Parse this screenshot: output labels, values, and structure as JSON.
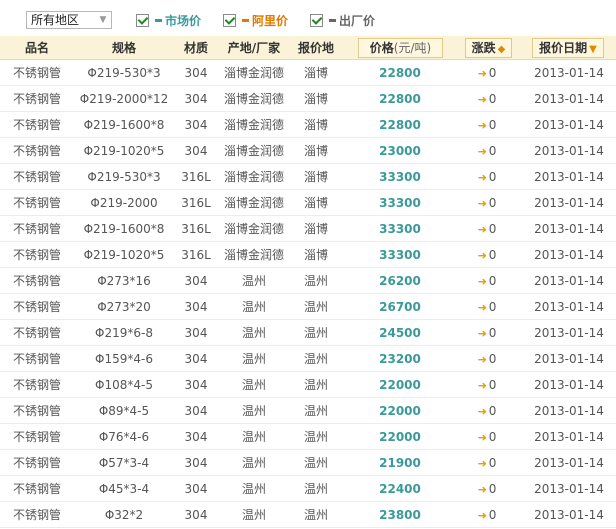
{
  "filter": {
    "region": "所有地区"
  },
  "legend": [
    {
      "label": "市场价",
      "color": "#3a9a9a"
    },
    {
      "label": "阿里价",
      "color": "#e07a00"
    },
    {
      "label": "出厂价",
      "color": "#666666"
    }
  ],
  "columns": {
    "name": "品名",
    "spec": "规格",
    "material": "材质",
    "maker": "产地/厂家",
    "place": "报价地",
    "price": "价格",
    "price_unit": "(元/吨)",
    "change": "涨跌",
    "date": "报价日期"
  },
  "rows": [
    {
      "name": "不锈钢管",
      "spec": "Φ219-530*3",
      "material": "304",
      "maker": "淄博金润德",
      "place": "淄博",
      "price": "22800",
      "change": "0",
      "date": "2013-01-14"
    },
    {
      "name": "不锈钢管",
      "spec": "Φ219-2000*12",
      "material": "304",
      "maker": "淄博金润德",
      "place": "淄博",
      "price": "22800",
      "change": "0",
      "date": "2013-01-14"
    },
    {
      "name": "不锈钢管",
      "spec": "Φ219-1600*8",
      "material": "304",
      "maker": "淄博金润德",
      "place": "淄博",
      "price": "22800",
      "change": "0",
      "date": "2013-01-14"
    },
    {
      "name": "不锈钢管",
      "spec": "Φ219-1020*5",
      "material": "304",
      "maker": "淄博金润德",
      "place": "淄博",
      "price": "23000",
      "change": "0",
      "date": "2013-01-14"
    },
    {
      "name": "不锈钢管",
      "spec": "Φ219-530*3",
      "material": "316L",
      "maker": "淄博金润德",
      "place": "淄博",
      "price": "33300",
      "change": "0",
      "date": "2013-01-14"
    },
    {
      "name": "不锈钢管",
      "spec": "Φ219-2000",
      "material": "316L",
      "maker": "淄博金润德",
      "place": "淄博",
      "price": "33300",
      "change": "0",
      "date": "2013-01-14"
    },
    {
      "name": "不锈钢管",
      "spec": "Φ219-1600*8",
      "material": "316L",
      "maker": "淄博金润德",
      "place": "淄博",
      "price": "33300",
      "change": "0",
      "date": "2013-01-14"
    },
    {
      "name": "不锈钢管",
      "spec": "Φ219-1020*5",
      "material": "316L",
      "maker": "淄博金润德",
      "place": "淄博",
      "price": "33300",
      "change": "0",
      "date": "2013-01-14"
    },
    {
      "name": "不锈钢管",
      "spec": "Φ273*16",
      "material": "304",
      "maker": "温州",
      "place": "温州",
      "price": "26200",
      "change": "0",
      "date": "2013-01-14"
    },
    {
      "name": "不锈钢管",
      "spec": "Φ273*20",
      "material": "304",
      "maker": "温州",
      "place": "温州",
      "price": "26700",
      "change": "0",
      "date": "2013-01-14"
    },
    {
      "name": "不锈钢管",
      "spec": "Φ219*6-8",
      "material": "304",
      "maker": "温州",
      "place": "温州",
      "price": "24500",
      "change": "0",
      "date": "2013-01-14"
    },
    {
      "name": "不锈钢管",
      "spec": "Φ159*4-6",
      "material": "304",
      "maker": "温州",
      "place": "温州",
      "price": "23200",
      "change": "0",
      "date": "2013-01-14"
    },
    {
      "name": "不锈钢管",
      "spec": "Φ108*4-5",
      "material": "304",
      "maker": "温州",
      "place": "温州",
      "price": "22000",
      "change": "0",
      "date": "2013-01-14"
    },
    {
      "name": "不锈钢管",
      "spec": "Φ89*4-5",
      "material": "304",
      "maker": "温州",
      "place": "温州",
      "price": "22000",
      "change": "0",
      "date": "2013-01-14"
    },
    {
      "name": "不锈钢管",
      "spec": "Φ76*4-6",
      "material": "304",
      "maker": "温州",
      "place": "温州",
      "price": "22000",
      "change": "0",
      "date": "2013-01-14"
    },
    {
      "name": "不锈钢管",
      "spec": "Φ57*3-4",
      "material": "304",
      "maker": "温州",
      "place": "温州",
      "price": "21900",
      "change": "0",
      "date": "2013-01-14"
    },
    {
      "name": "不锈钢管",
      "spec": "Φ45*3-4",
      "material": "304",
      "maker": "温州",
      "place": "温州",
      "price": "22400",
      "change": "0",
      "date": "2013-01-14"
    },
    {
      "name": "不锈钢管",
      "spec": "Φ32*2",
      "material": "304",
      "maker": "温州",
      "place": "温州",
      "price": "23800",
      "change": "0",
      "date": "2013-01-14"
    }
  ]
}
